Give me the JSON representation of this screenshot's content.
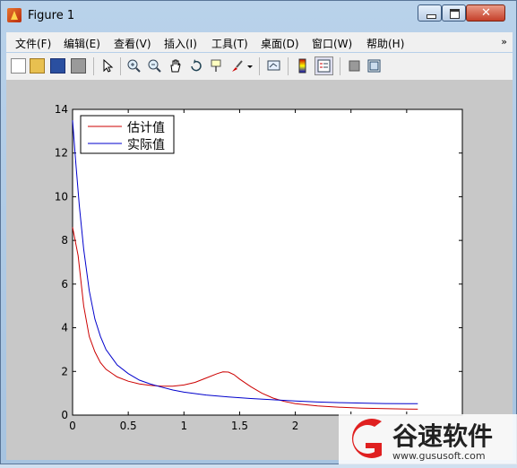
{
  "window": {
    "title": "Figure 1"
  },
  "menu": [
    "文件(F)",
    "编辑(E)",
    "查看(V)",
    "插入(I)",
    "工具(T)",
    "桌面(D)",
    "窗口(W)",
    "帮助(H)"
  ],
  "menu_overflow": "»",
  "toolbar": [
    {
      "icon": "new-figure-icon"
    },
    {
      "icon": "open-file-icon"
    },
    {
      "icon": "save-icon"
    },
    {
      "icon": "print-icon"
    },
    {
      "icon": "pointer-arrow-icon"
    },
    {
      "icon": "zoom-in-icon"
    },
    {
      "icon": "zoom-out-icon"
    },
    {
      "icon": "pan-hand-icon"
    },
    {
      "icon": "rotate-3d-icon"
    },
    {
      "icon": "data-cursor-icon"
    },
    {
      "icon": "brush-icon"
    },
    {
      "icon": "dropdown-arrow-icon"
    },
    {
      "icon": "link-plot-icon"
    },
    {
      "icon": "colorbar-icon"
    },
    {
      "icon": "legend-toggle-icon"
    },
    {
      "icon": "hide-plot-tools-icon"
    },
    {
      "icon": "show-plot-tools-icon"
    }
  ],
  "chart_data": {
    "type": "line",
    "xlim": [
      0,
      3.5
    ],
    "ylim": [
      0,
      14
    ],
    "x_ticks": [
      0,
      0.5,
      1,
      1.5,
      2,
      2.5,
      3,
      3.5
    ],
    "x_tick_labels": [
      "0",
      "0.5",
      "1",
      "1.5",
      "2",
      "",
      "",
      ""
    ],
    "y_ticks": [
      0,
      2,
      4,
      6,
      8,
      10,
      12,
      14
    ],
    "y_tick_labels": [
      "0",
      "2",
      "4",
      "6",
      "8",
      "10",
      "12",
      "14"
    ],
    "grid": false,
    "legend_position": "top-left",
    "series": [
      {
        "name": "估计值",
        "color": "#cc0000",
        "x": [
          0,
          0.05,
          0.1,
          0.15,
          0.2,
          0.25,
          0.3,
          0.4,
          0.5,
          0.6,
          0.7,
          0.8,
          0.9,
          1.0,
          1.1,
          1.2,
          1.3,
          1.35,
          1.4,
          1.45,
          1.5,
          1.6,
          1.7,
          1.8,
          1.9,
          2.0,
          2.2,
          2.4,
          2.6,
          2.8,
          3.0,
          3.1
        ],
        "y": [
          8.6,
          7.3,
          5.0,
          3.6,
          2.9,
          2.4,
          2.1,
          1.75,
          1.55,
          1.43,
          1.36,
          1.32,
          1.32,
          1.38,
          1.5,
          1.7,
          1.9,
          1.98,
          1.97,
          1.85,
          1.65,
          1.3,
          1.0,
          0.78,
          0.63,
          0.52,
          0.42,
          0.36,
          0.32,
          0.3,
          0.28,
          0.27
        ]
      },
      {
        "name": "实际值",
        "color": "#0000cc",
        "x": [
          0,
          0.03,
          0.06,
          0.1,
          0.15,
          0.2,
          0.25,
          0.3,
          0.4,
          0.5,
          0.6,
          0.7,
          0.8,
          0.9,
          1.0,
          1.2,
          1.4,
          1.6,
          1.8,
          2.0,
          2.2,
          2.4,
          2.6,
          2.8,
          3.0,
          3.1
        ],
        "y": [
          13.5,
          11.5,
          9.6,
          7.6,
          5.7,
          4.4,
          3.6,
          3.0,
          2.3,
          1.9,
          1.6,
          1.42,
          1.28,
          1.15,
          1.05,
          0.92,
          0.83,
          0.76,
          0.7,
          0.65,
          0.6,
          0.57,
          0.55,
          0.53,
          0.52,
          0.52
        ]
      }
    ]
  },
  "watermark": {
    "brand": "谷速软件",
    "url": "www.gususoft.com",
    "accent": "#e02020"
  }
}
